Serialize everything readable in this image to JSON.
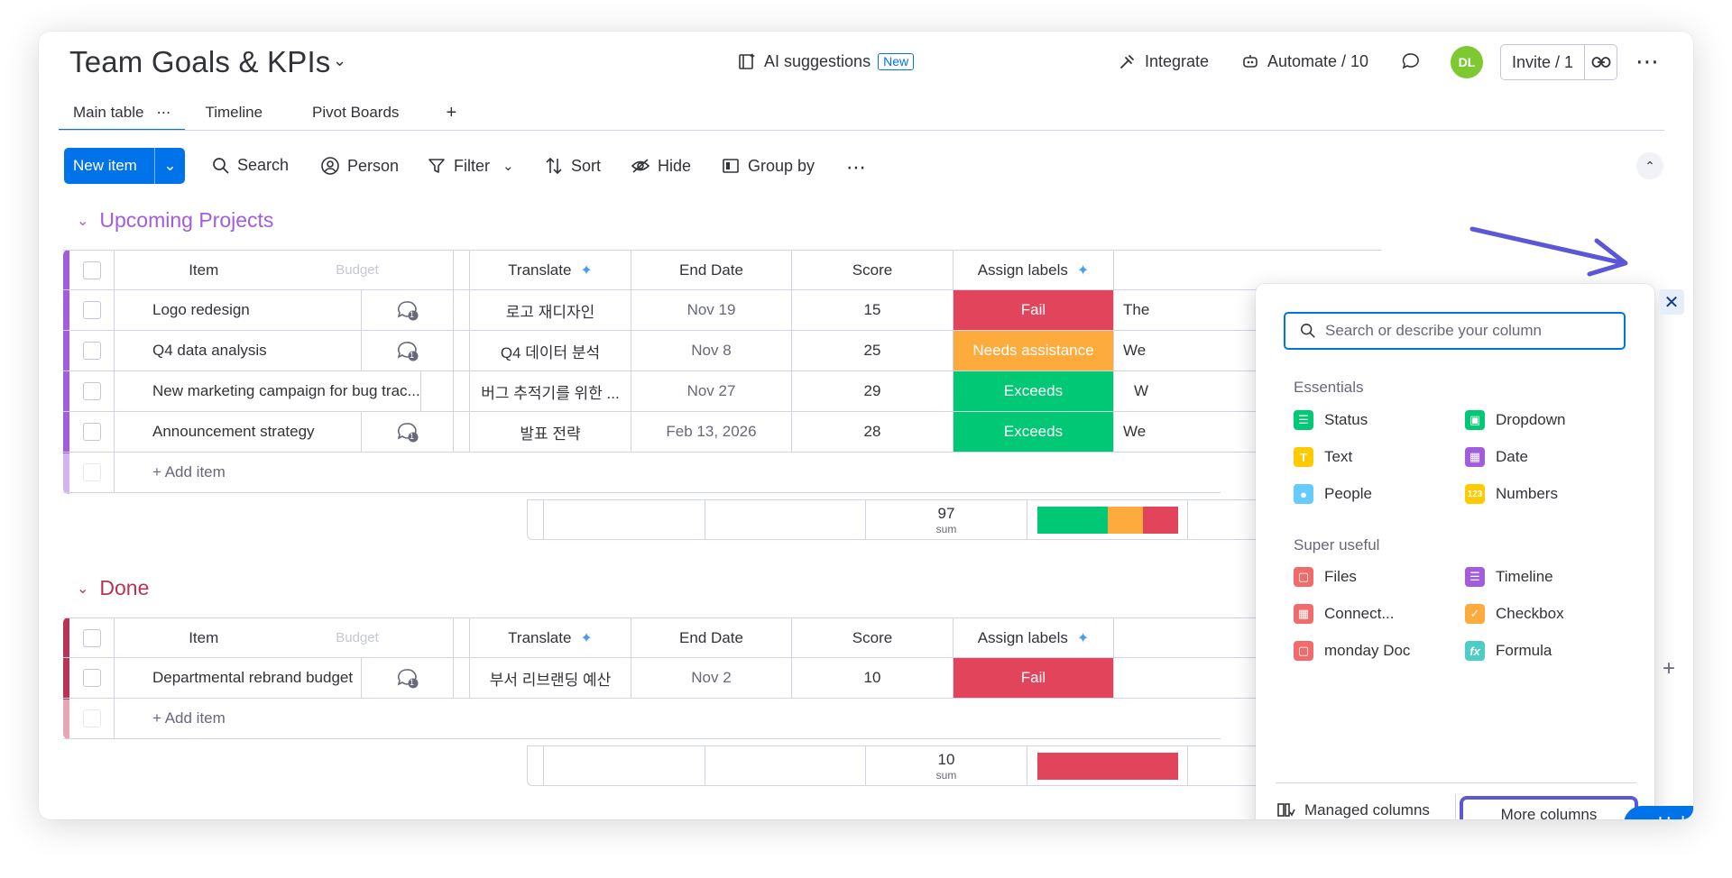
{
  "header": {
    "title": "Team Goals & KPIs",
    "ai_suggestions": "AI suggestions",
    "new_badge": "New",
    "integrate": "Integrate",
    "automate": "Automate / 10",
    "avatar": "DL",
    "invite": "Invite / 1"
  },
  "tabs": [
    {
      "label": "Main table"
    },
    {
      "label": "Timeline"
    },
    {
      "label": "Pivot Boards"
    }
  ],
  "toolbar": {
    "new_item": "New item",
    "search": "Search",
    "person": "Person",
    "filter": "Filter",
    "sort": "Sort",
    "hide": "Hide",
    "group_by": "Group by"
  },
  "columns": {
    "item": "Item",
    "budget_ghost": "Budget",
    "translate": "Translate",
    "end_date": "End Date",
    "score": "Score",
    "assign_labels": "Assign labels"
  },
  "groups": [
    {
      "title": "Upcoming Projects",
      "color": "#a25ddc",
      "rows": [
        {
          "item": "Logo redesign",
          "updates": "1",
          "translate": "로고 재디자인",
          "end_date": "Nov 19",
          "score": "15",
          "label": "Fail",
          "label_color": "#e2445c",
          "extra": "The"
        },
        {
          "item": "Q4 data analysis",
          "updates": "1",
          "translate": "Q4 데이터 분석",
          "end_date": "Nov 8",
          "score": "25",
          "label": "Needs assistance",
          "label_color": "#fdab3d",
          "extra": "We"
        },
        {
          "item": "New marketing campaign for bug trac...",
          "updates": "1",
          "translate": "버그 추적기를 위한 ...",
          "end_date": "Nov 27",
          "score": "29",
          "label": "Exceeds",
          "label_color": "#00c875",
          "extra": "W"
        },
        {
          "item": "Announcement strategy",
          "updates": "1",
          "translate": "발표 전략",
          "end_date": "Feb 13, 2026",
          "score": "28",
          "label": "Exceeds",
          "label_color": "#00c875",
          "extra": "We"
        }
      ],
      "add_item": "+ Add item",
      "sum_value": "97",
      "sum_label": "sum"
    },
    {
      "title": "Done",
      "color": "#bb3354",
      "rows": [
        {
          "item": "Departmental rebrand budget",
          "updates": "1",
          "translate": "부서 리브랜딩 예산",
          "end_date": "Nov 2",
          "score": "10",
          "label": "Fail",
          "label_color": "#e2445c",
          "extra": ""
        }
      ],
      "add_item": "+ Add item",
      "sum_value": "10",
      "sum_label": "sum"
    }
  ],
  "popup": {
    "search_placeholder": "Search or describe your column",
    "essentials_title": "Essentials",
    "essentials": [
      {
        "label": "Status",
        "icon": "status-icon",
        "color": "#00c875"
      },
      {
        "label": "Dropdown",
        "icon": "dropdown-icon",
        "color": "#00c875"
      },
      {
        "label": "Text",
        "icon": "text-icon",
        "color": "#ffcb00"
      },
      {
        "label": "Date",
        "icon": "date-icon",
        "color": "#a25ddc"
      },
      {
        "label": "People",
        "icon": "people-icon",
        "color": "#66ccff"
      },
      {
        "label": "Numbers",
        "icon": "numbers-icon",
        "color": "#ffcb00"
      }
    ],
    "super_title": "Super useful",
    "super": [
      {
        "label": "Files",
        "icon": "files-icon",
        "color": "#f06c6c"
      },
      {
        "label": "Timeline",
        "icon": "timeline-icon",
        "color": "#a25ddc"
      },
      {
        "label": "Connect...",
        "icon": "connect-icon",
        "color": "#f06c6c"
      },
      {
        "label": "Checkbox",
        "icon": "checkbox-icon",
        "color": "#fdab3d"
      },
      {
        "label": "monday Doc",
        "icon": "doc-icon",
        "color": "#f06c6c"
      },
      {
        "label": "Formula",
        "icon": "formula-icon",
        "color": "#4eccc6"
      }
    ],
    "managed": "Managed columns",
    "more": "More columns"
  },
  "help": "Help"
}
